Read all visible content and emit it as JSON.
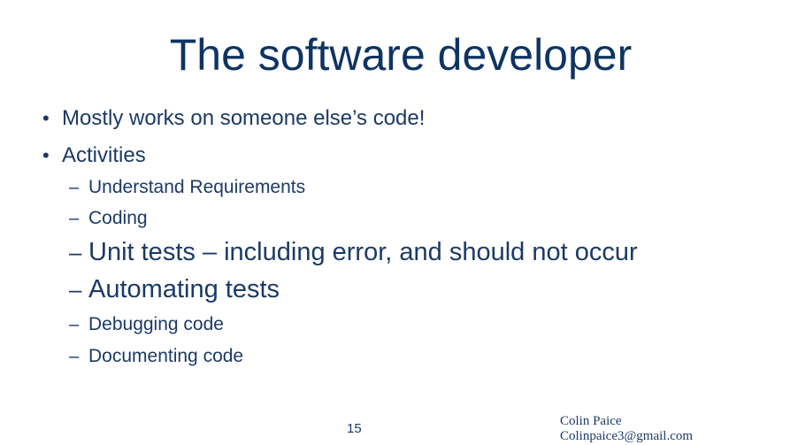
{
  "slide": {
    "title": "The software developer",
    "bullets": [
      "Mostly works on someone else’s code!",
      "Activities"
    ],
    "bullet_glyph": "•",
    "dash_glyph": "–",
    "sub_items": [
      "Understand Requirements",
      "Coding",
      "Unit tests – including error, and should not occur",
      "Automating tests",
      "Debugging code",
      "Documenting code"
    ]
  },
  "footer": {
    "page_number": "15",
    "author_name": "Colin Paice",
    "author_email": "Colinpaice3@gmail.com"
  }
}
